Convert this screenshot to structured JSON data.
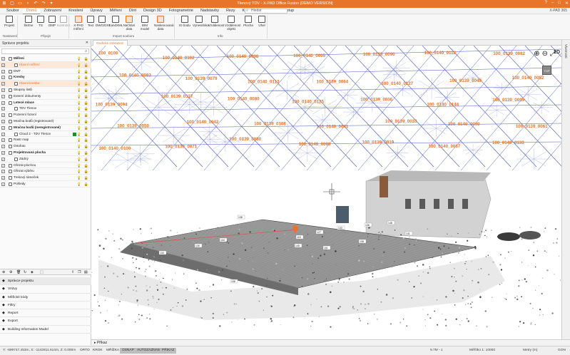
{
  "app": {
    "title": "Tlenový TDV - X-PAD Office Fusion [DEMO VERSION]",
    "brand": "X-PAD 365"
  },
  "menu": {
    "tabs": [
      "Soubor",
      "Domů",
      "Zobrazení",
      "Kreslení",
      "Úpravy",
      "Měření",
      "Dírit",
      "Design 3D",
      "Fotogrametrie",
      "Nadstavby",
      "Rezy",
      "Katastr",
      "Mračno",
      "Výstup"
    ],
    "active_index": 1,
    "search_placeholder": "Hledat"
  },
  "ribbon": {
    "buttons": [
      {
        "label": "Projekt",
        "icon": "project-icon"
      },
      {
        "label": "Škrtne",
        "icon": "notes-icon"
      },
      {
        "label": "TS",
        "icon": "total-station-icon"
      },
      {
        "label": "DMP",
        "icon": "dmp-icon"
      },
      {
        "label": "Kontroler",
        "icon": "controller-icon"
      },
      {
        "label": "X-PAD měření",
        "icon": "xpad-icon"
      },
      {
        "label": "Text",
        "icon": "text-icon"
      },
      {
        "label": "DWG/DXF",
        "icon": "dwg-icon"
      },
      {
        "label": "LandXML",
        "icon": "landxml-icon"
      },
      {
        "label": "Načítání data",
        "icon": "load-data-icon"
      },
      {
        "label": "BIM model",
        "icon": "bim-icon"
      },
      {
        "label": "Naskenovaná data",
        "icon": "scan-icon"
      },
      {
        "label": "ID bodu",
        "icon": "point-id-icon"
      },
      {
        "label": "Vynesitlnka",
        "icon": "line-icon"
      },
      {
        "label": "Vzdálenost",
        "icon": "distance-icon"
      },
      {
        "label": "Vzdálenost objekt",
        "icon": "distance-object-icon"
      },
      {
        "label": "Plocha",
        "icon": "area-icon"
      },
      {
        "label": "Úhel",
        "icon": "angle-icon"
      }
    ],
    "groups": [
      "Nastavení",
      "Připojit",
      "Import souboru",
      "Info"
    ]
  },
  "leftpanel": {
    "title": "Správce projektu",
    "tree": [
      {
        "label": "Měření",
        "level": 0,
        "bold": true,
        "icon": "survey-icon"
      },
      {
        "label": "Hlavní měření",
        "level": 2,
        "orange": true,
        "icon": "pen-icon"
      },
      {
        "label": "DMT",
        "level": 0,
        "icon": "dmt-icon"
      },
      {
        "label": "Kresby",
        "level": 0,
        "bold": true,
        "icon": "drawing-icon"
      },
      {
        "label": "Hlavní kresba",
        "level": 2,
        "orange": true,
        "icon": "pen-icon"
      },
      {
        "label": "Skupiny listů",
        "level": 0,
        "icon": "sheets-icon"
      },
      {
        "label": "Externí dokumenty",
        "level": 0,
        "icon": "docs-icon"
      },
      {
        "label": "Letecé mlace",
        "level": 0,
        "bold": true,
        "icon": "flight-icon"
      },
      {
        "label": "TDV Tlenov",
        "level": 2,
        "icon": "flight-item-icon"
      },
      {
        "label": "Pozemní fození",
        "level": 0,
        "icon": "camera-icon"
      },
      {
        "label": "Mračna bodů (registrované)",
        "level": 0,
        "icon": "cloud-icon"
      },
      {
        "label": "Mračna bodů (neregistrované)",
        "level": 0,
        "bold": true,
        "icon": "cloud-icon"
      },
      {
        "label": "Cloud 2 - TDV Tlenov",
        "level": 2,
        "icon": "cloud-item-icon",
        "swatch": "#1f8b2b"
      },
      {
        "label": "Rastr map",
        "level": 0,
        "icon": "raster-icon"
      },
      {
        "label": "Ortofoto",
        "level": 0,
        "icon": "ortho-icon"
      },
      {
        "label": "Projektovaná plocha",
        "level": 0,
        "bold": true,
        "icon": "design-icon"
      },
      {
        "label": "Zádný",
        "level": 2,
        "icon": "pen-icon"
      },
      {
        "label": "Ořezat plochou",
        "level": 0,
        "icon": "clip-area-icon"
      },
      {
        "label": "Ořezat výběru",
        "level": 0,
        "icon": "clip-sel-icon"
      },
      {
        "label": "Trekový rámeček",
        "level": 0,
        "icon": "frame-icon"
      },
      {
        "label": "Pohledy",
        "level": 0,
        "icon": "views-icon"
      }
    ],
    "nav": [
      {
        "label": "Správce projektu",
        "icon": "project-manager-icon",
        "selected": true
      },
      {
        "label": "Vrstvy",
        "icon": "layers-icon"
      },
      {
        "label": "Měřické kódy",
        "icon": "codes-icon"
      },
      {
        "label": "Filtry",
        "icon": "filter-icon"
      },
      {
        "label": "Report",
        "icon": "report-icon"
      },
      {
        "label": "Export",
        "icon": "export-icon"
      },
      {
        "label": "Building Information Model",
        "icon": "bim-nav-icon"
      }
    ]
  },
  "viewport": {
    "tab": "Grafické zobrazení",
    "mode_2d": "2D",
    "cube_label": "TOP",
    "point_labels": [
      "100_0100",
      "100_0140_0102",
      "100_0140_0098",
      "100_0140_0095",
      "100_0139_0090",
      "100_0140_0118",
      "100_0139_0082",
      "100_0140_0083",
      "100_0139_0079",
      "100_0140_0113",
      "100_0139_0064",
      "100_0140_0127",
      "100_0139_0049",
      "100_0140_0052",
      "100_0139_0094",
      "100_0139_0117",
      "100_0140_0080",
      "100_0140_0125",
      "100_0139_0036",
      "100_0140_0144",
      "100_0139_0039",
      "100_0139_0050",
      "100_0140_0042",
      "100_0139_0108",
      "100_0140_0041",
      "100_0139_0033",
      "100_0140_0090",
      "100_0139_0061",
      "100_0140_0100",
      "100_0139_0071",
      "100_0139_0080",
      "100_0140_0080",
      "100_0139_0019",
      "100_0140_0067",
      "100_0140_0133"
    ],
    "building_labels": [
      "118",
      "127",
      "133",
      "136",
      "148",
      "141",
      "145",
      "151",
      "108",
      "138",
      "134",
      "130",
      "134",
      "108"
    ]
  },
  "command": {
    "label": "Příkaz"
  },
  "status": {
    "coords": "Y: -699747.453m, X: -1142811.614m, Z: 0.000m",
    "toggles": [
      {
        "label": "ORTO",
        "on": false
      },
      {
        "label": "KROK",
        "on": false
      },
      {
        "label": "MŘÍŽKA",
        "on": false
      },
      {
        "label": "OSNAP",
        "on": true
      },
      {
        "label": "AUTOZAZNAM",
        "on": true
      },
      {
        "label": "PŘIKAZ",
        "on": true
      }
    ],
    "size": "9.7M - 1",
    "scale": "Měřítko 1: 10000",
    "units": "Metry (m)",
    "angle": "GON"
  }
}
